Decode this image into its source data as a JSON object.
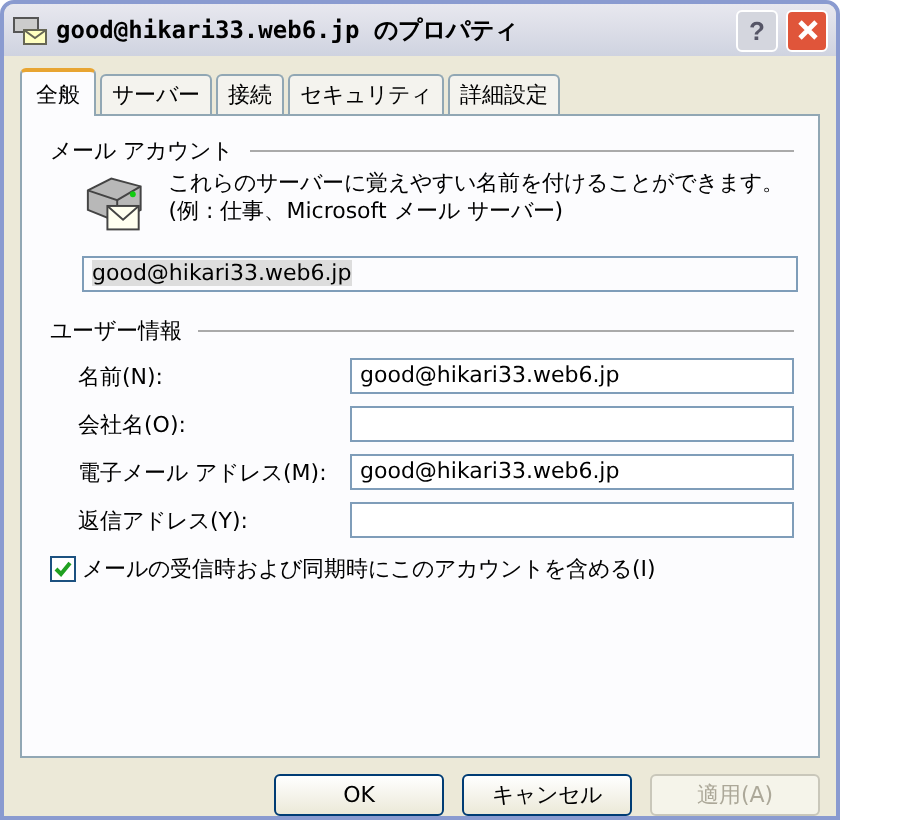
{
  "window": {
    "title": "good@hikari33.web6.jp のプロパティ",
    "help_button": "?"
  },
  "tabs": [
    {
      "label": "全般",
      "selected": true
    },
    {
      "label": "サーバー",
      "selected": false
    },
    {
      "label": "接続",
      "selected": false
    },
    {
      "label": "セキュリティ",
      "selected": false
    },
    {
      "label": "詳細設定",
      "selected": false
    }
  ],
  "mail_account": {
    "heading": "メール アカウント",
    "description": "これらのサーバーに覚えやすい名前を付けることができます。(例 : 仕事、Microsoft メール サーバー)",
    "account_name": "good@hikari33.web6.jp"
  },
  "user_info": {
    "heading": "ユーザー情報",
    "fields": [
      {
        "label": "名前(N):",
        "value": "good@hikari33.web6.jp"
      },
      {
        "label": "会社名(O):"
      },
      {
        "label": "電子メール アドレス(M):",
        "value": "good@hikari33.web6.jp"
      },
      {
        "label": "返信アドレス(Y):"
      }
    ]
  },
  "include_account": {
    "label": "メールの受信時および同期時にこのアカウントを含める(I)",
    "checked": true
  },
  "buttons": [
    {
      "label": "OK",
      "disabled": false
    },
    {
      "label": "キャンセル",
      "disabled": false
    },
    {
      "label": "適用(A)",
      "disabled": true
    }
  ]
}
